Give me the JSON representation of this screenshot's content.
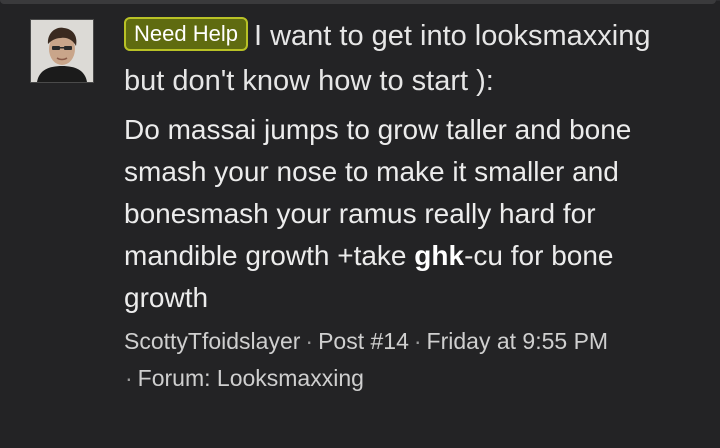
{
  "result": {
    "prefix_label": "Need Help",
    "title": "I want to get into looksmaxxing but don't know how to start ):",
    "snippet": {
      "before": "Do massai jumps to grow taller and bone smash your nose to make it smaller and bonesmash your ramus really hard for mandible growth +take ",
      "highlight": "ghk",
      "after": "-cu for bone growth"
    },
    "meta": {
      "author": "ScottyTfoidslayer",
      "post": "Post #14",
      "date": "Friday at 9:55 PM",
      "forum": "Forum: Looksmaxxing",
      "separator": "·"
    }
  },
  "colors": {
    "background": "#232325",
    "badge_bg": "#5f6b10",
    "badge_border": "#b8c126",
    "text": "#e6e6e6"
  },
  "icons": {
    "avatar": "user-avatar-photo"
  }
}
